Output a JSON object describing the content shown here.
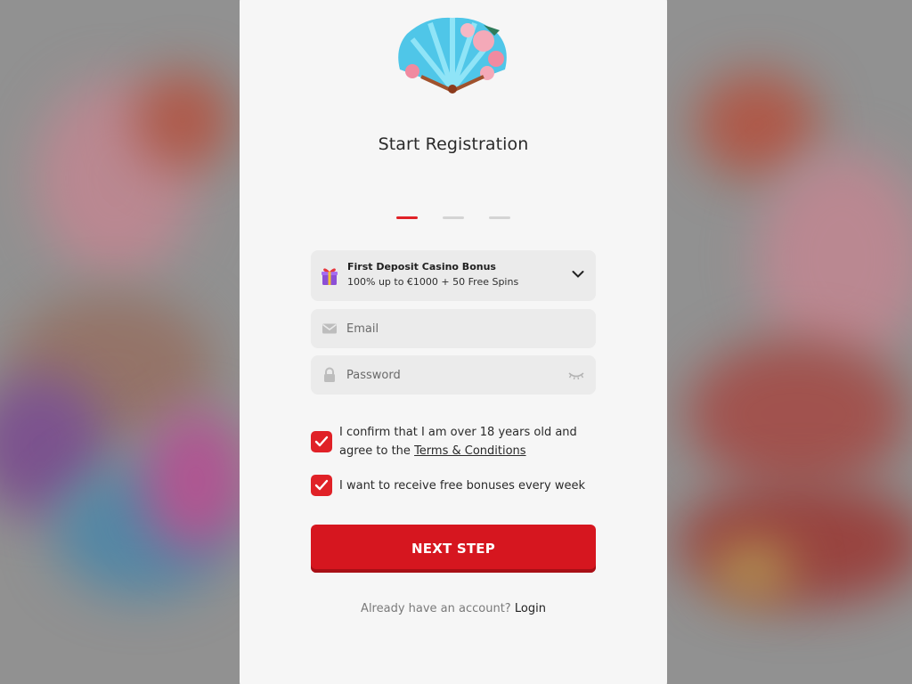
{
  "registration": {
    "title": "Start Registration",
    "steps": 3,
    "active_step": 1
  },
  "bonus_select": {
    "title": "First Deposit Casino Bonus",
    "description": "100% up to €1000 + 50 Free Spins",
    "icon": "gift-icon",
    "toggle_icon": "chevron-down-icon"
  },
  "email": {
    "placeholder": "Email",
    "value": "",
    "icon": "envelope-icon"
  },
  "password": {
    "placeholder": "Password",
    "value": "",
    "icon": "lock-icon",
    "visibility_icon": "eye-closed-icon"
  },
  "consent": {
    "age_text": "I confirm that I am over 18 years old and agree to the ",
    "terms_link": "Terms & Conditions",
    "age_checked": true,
    "bonus_text": "I want to receive free bonuses every week",
    "bonus_checked": true
  },
  "next_button": {
    "label": "NEXT STEP"
  },
  "footer": {
    "prompt": "Already have an account?",
    "login_link": "Login"
  },
  "colors": {
    "accent": "#e02127",
    "button": "#d6161f",
    "card": "#f6f6f6",
    "field": "#ebebeb"
  }
}
